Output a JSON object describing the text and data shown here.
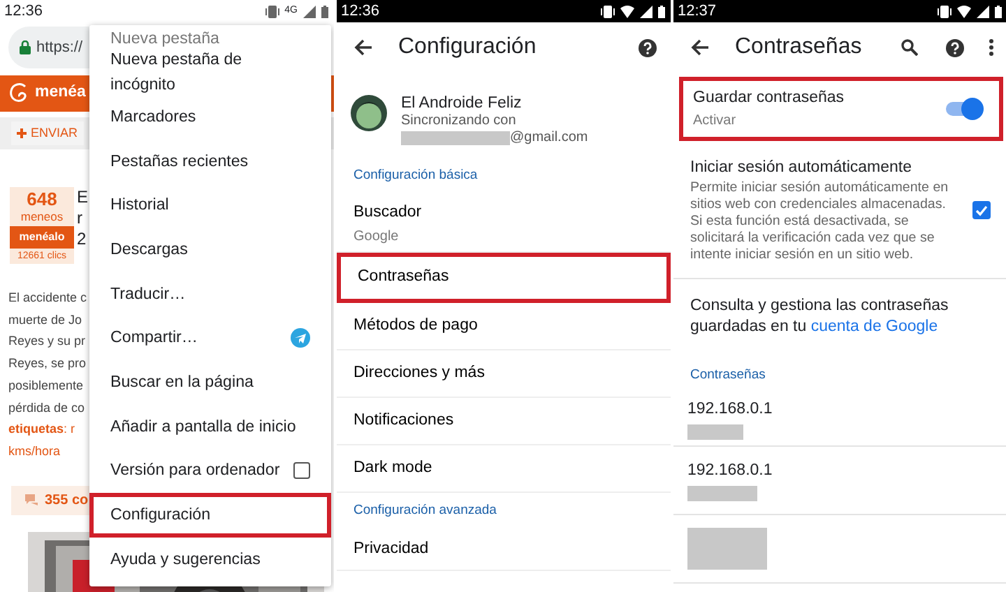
{
  "browser_screen": {
    "status_bar": {
      "time": "12:36",
      "network": "4G"
    },
    "address_bar": {
      "url": "https://"
    },
    "site_header": {
      "logo": "menéa"
    },
    "toolbar": {
      "button": "ENVIAR"
    },
    "story": {
      "votes": "648",
      "votes_label": "meneos",
      "vote_button": "menéalo",
      "clicks": "12661 clics",
      "title_lines": [
        "E",
        "r",
        "2"
      ]
    },
    "body_lines": [
      {
        "kind": "text",
        "text": "El accidente c"
      },
      {
        "kind": "text",
        "text": "muerte de Jo"
      },
      {
        "kind": "text",
        "text": "Reyes y su pr"
      },
      {
        "kind": "text",
        "text": "Reyes, se pro"
      },
      {
        "kind": "text",
        "text": "posiblemente"
      },
      {
        "kind": "text",
        "text": "pérdida de co"
      },
      {
        "kind": "tags",
        "text": "**etiquetas**: r"
      },
      {
        "kind": "tags",
        "text": "kms/hora"
      }
    ],
    "comments": "355 co",
    "menu": {
      "items": [
        {
          "label": "Nueva pestaña",
          "kind": "plain",
          "highlighted": false
        },
        {
          "label": "Nueva pestaña de incógnito",
          "kind": "plain",
          "highlighted": false
        },
        {
          "label": "Marcadores",
          "kind": "plain",
          "highlighted": false
        },
        {
          "label": "Pestañas recientes",
          "kind": "plain",
          "highlighted": false
        },
        {
          "label": "Historial",
          "kind": "plain",
          "highlighted": false
        },
        {
          "label": "Descargas",
          "kind": "plain",
          "highlighted": false
        },
        {
          "label": "Traducir…",
          "kind": "plain",
          "highlighted": false
        },
        {
          "label": "Compartir…",
          "kind": "share",
          "highlighted": false
        },
        {
          "label": "Buscar en la página",
          "kind": "plain",
          "highlighted": false
        },
        {
          "label": "Añadir a pantalla de inicio",
          "kind": "plain",
          "highlighted": false
        },
        {
          "label": "Versión para ordenador",
          "kind": "checkbox",
          "checked": false,
          "highlighted": false
        },
        {
          "label": "Configuración",
          "kind": "plain",
          "highlighted": true
        },
        {
          "label": "Ayuda y sugerencias",
          "kind": "plain",
          "highlighted": false
        }
      ]
    }
  },
  "settings_screen": {
    "status_bar": {
      "time": "12:36"
    },
    "title": "Configuración",
    "account": {
      "name": "El Androide Feliz",
      "sync_label": "Sincronizando con",
      "email_suffix": "@gmail.com"
    },
    "rows": [
      {
        "kind": "section",
        "label": "Configuración básica"
      },
      {
        "kind": "item",
        "label": "Buscador",
        "sublabel": "Google",
        "highlighted": false
      },
      {
        "kind": "item",
        "label": "Contraseñas",
        "highlighted": true
      },
      {
        "kind": "item",
        "label": "Métodos de pago",
        "highlighted": false
      },
      {
        "kind": "item",
        "label": "Direcciones y más",
        "highlighted": false
      },
      {
        "kind": "item",
        "label": "Notificaciones",
        "highlighted": false
      },
      {
        "kind": "item",
        "label": "Dark mode",
        "highlighted": false
      },
      {
        "kind": "section",
        "label": "Configuración avanzada"
      },
      {
        "kind": "item",
        "label": "Privacidad",
        "highlighted": false
      }
    ]
  },
  "passwords_screen": {
    "status_bar": {
      "time": "12:37"
    },
    "title": "Contraseñas",
    "save_passwords": {
      "label": "Guardar contraseñas",
      "sublabel": "Activar",
      "on": true,
      "highlighted": true
    },
    "auto_signin": {
      "label": "Iniciar sesión automáticamente",
      "description": "Permite iniciar sesión automáticamente en sitios web con credenciales almacenadas. Si esta función está desactivada, se solicitará la verificación cada vez que se intente iniciar sesión en un sitio web.",
      "checked": true
    },
    "manage": {
      "text": "Consulta y gestiona las contraseñas guardadas en tu",
      "link": "cuenta de Google"
    },
    "section": "Contraseñas",
    "entries": [
      {
        "kind": "site",
        "site": "192.168.0.1"
      },
      {
        "kind": "site",
        "site": "192.168.0.1"
      },
      {
        "kind": "redacted"
      }
    ]
  }
}
